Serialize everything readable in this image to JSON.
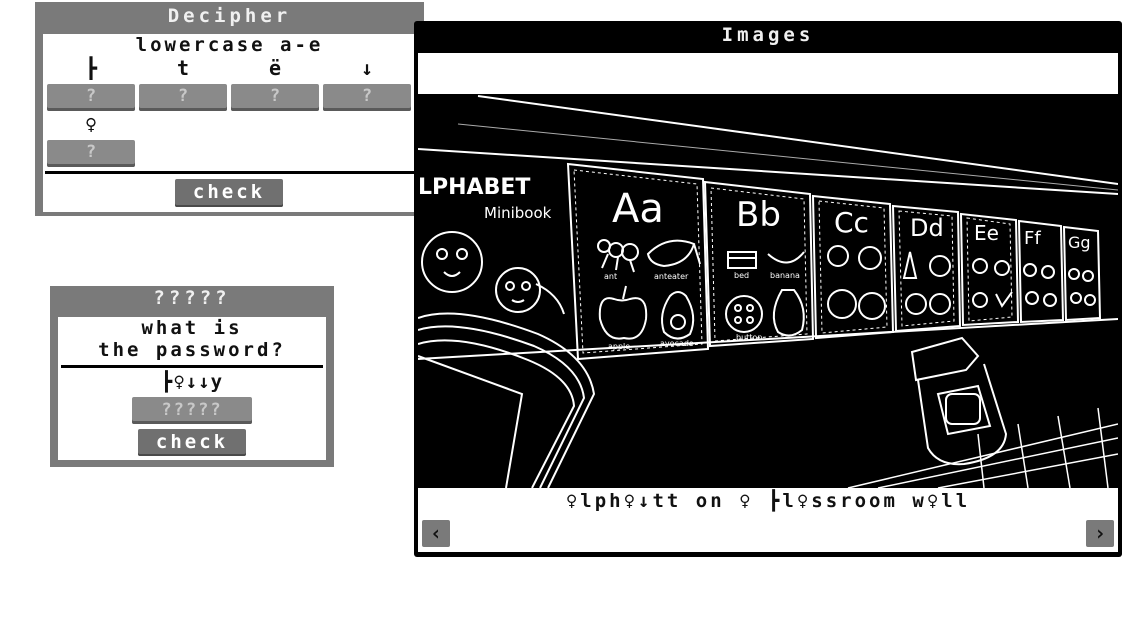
{
  "decipher": {
    "title": "Decipher",
    "subtitle": "lowercase a-e",
    "symbols": [
      "┣",
      "t",
      "ë",
      "↓",
      "♀"
    ],
    "slot_value": "?",
    "check_label": "check"
  },
  "password_panel": {
    "title": "?????",
    "question_line1": "what is",
    "question_line2": "the password?",
    "cipher": "┣♀↓↓y",
    "input_placeholder": "?????",
    "check_label": "check"
  },
  "images": {
    "title": "Images",
    "caption": "♀lph♀↓tt on ♀ ┣l♀ssroom w♀ll",
    "prev_icon": "‹",
    "next_icon": "›",
    "photo_texts": {
      "alphabet": "LPHABET",
      "minibook": "Minibook",
      "aa": "Aa",
      "bb": "Bb",
      "cc": "Cc",
      "dd": "Dd",
      "ee": "Ee",
      "ff": "Ff",
      "gg": "Gg",
      "ant": "ant",
      "anteater": "anteater",
      "bed": "bed",
      "banana": "banana",
      "apple": "apple",
      "avocado": "avocado",
      "button": "button"
    }
  }
}
